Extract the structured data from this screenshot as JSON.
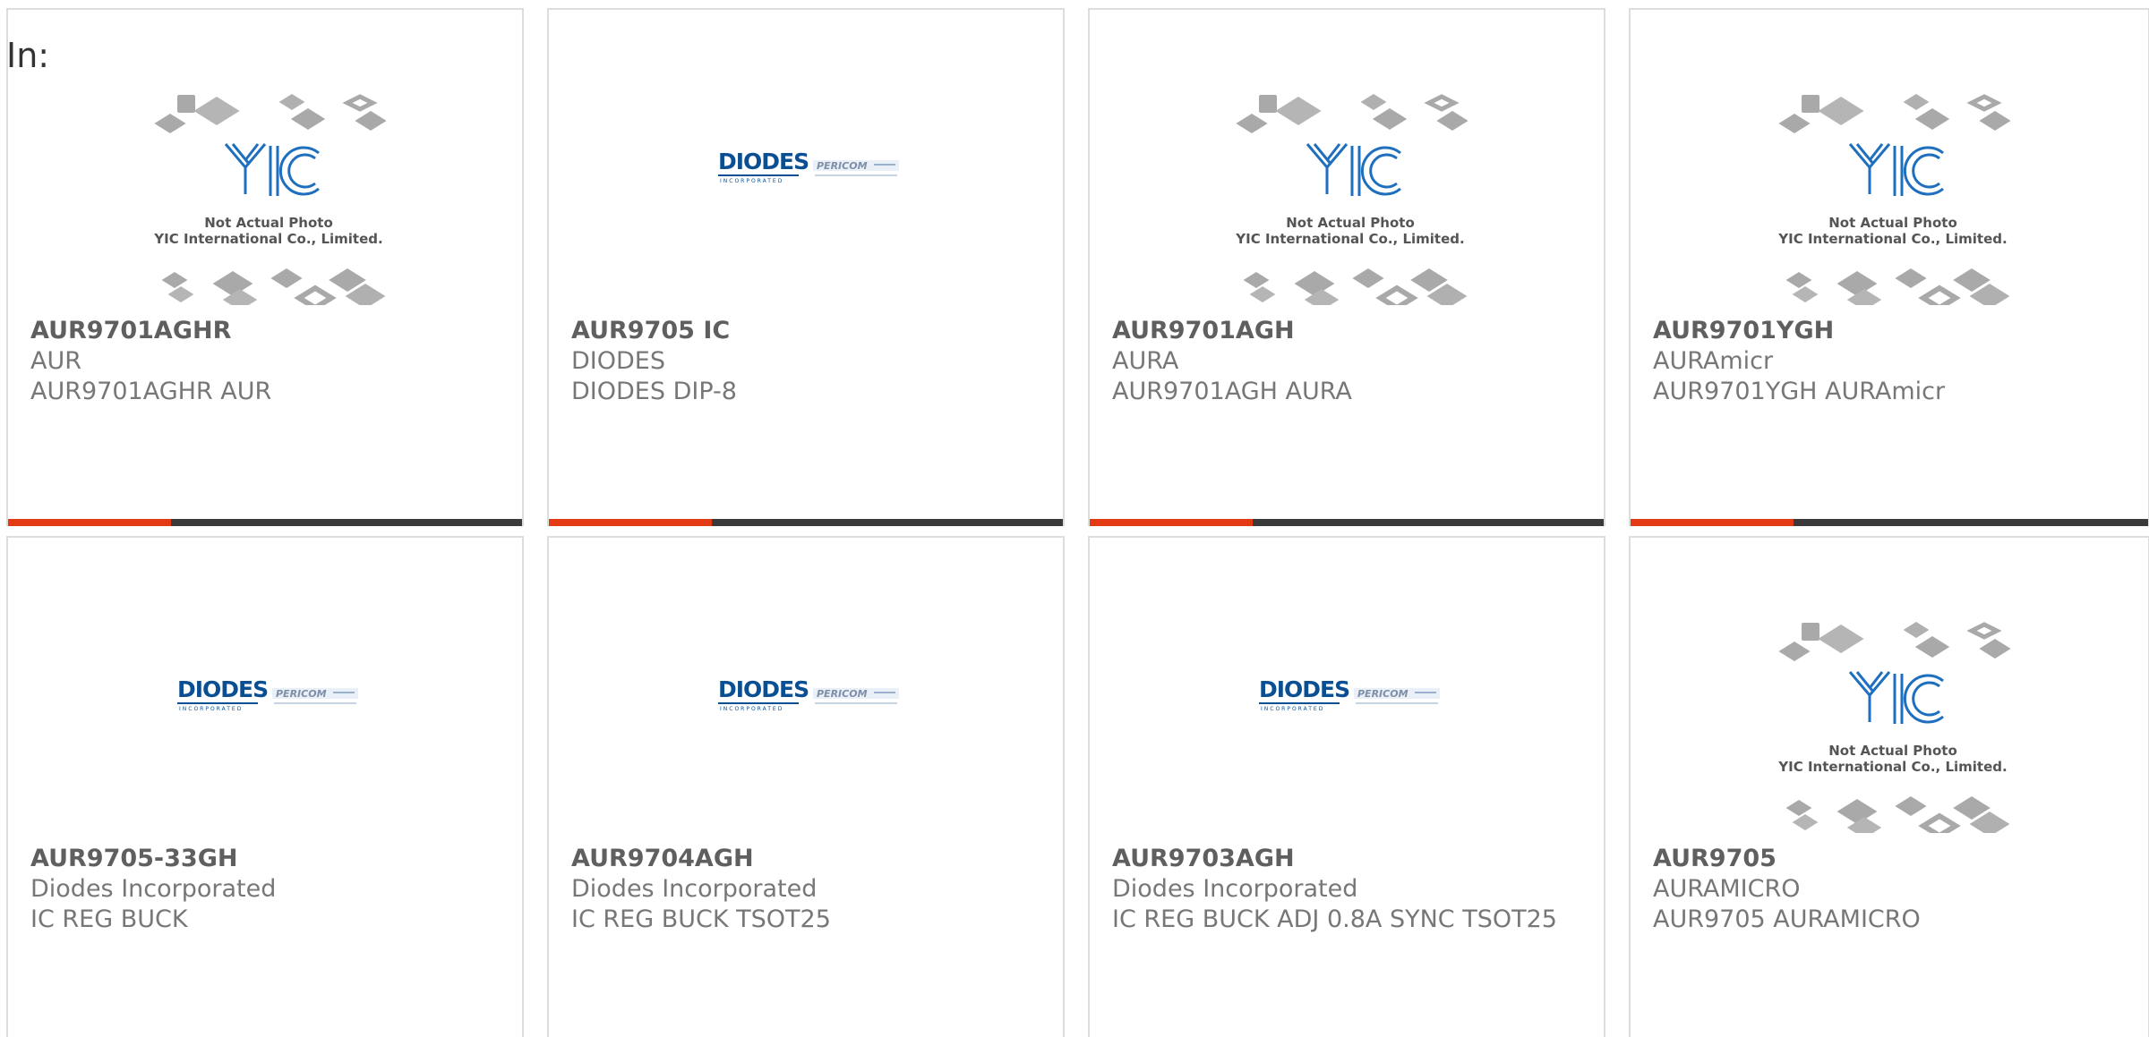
{
  "page": {
    "in_label": "In:"
  },
  "placeholder": {
    "line1": "Not Actual Photo",
    "line2": "YIC International Co., Limited.",
    "logo_text": "YIC"
  },
  "diodes_logo": {
    "brand": "DIODES",
    "sub": "INCORPORATED",
    "partner": "PERICOM"
  },
  "colors": {
    "accent": "#e23a12",
    "bar": "#3a3a3a",
    "text": "#777777",
    "title": "#5f5f5f"
  },
  "products": [
    {
      "part": "AUR9701AGHR",
      "manufacturer": "AUR",
      "description": "AUR9701AGHR AUR",
      "image": "placeholder"
    },
    {
      "part": "AUR9705 IC",
      "manufacturer": "DIODES",
      "description": "DIODES DIP-8",
      "image": "diodes-logo"
    },
    {
      "part": "AUR9701AGH",
      "manufacturer": "AURA",
      "description": "AUR9701AGH AURA",
      "image": "placeholder"
    },
    {
      "part": "AUR9701YGH",
      "manufacturer": "AURAmicr",
      "description": "AUR9701YGH AURAmicr",
      "image": "placeholder"
    },
    {
      "part": "AUR9705-33GH",
      "manufacturer": "Diodes Incorporated",
      "description": "IC REG BUCK",
      "image": "diodes-logo"
    },
    {
      "part": "AUR9704AGH",
      "manufacturer": "Diodes Incorporated",
      "description": "IC REG BUCK TSOT25",
      "image": "diodes-logo"
    },
    {
      "part": "AUR9703AGH",
      "manufacturer": "Diodes Incorporated",
      "description": "IC REG BUCK ADJ 0.8A SYNC TSOT25",
      "image": "diodes-logo"
    },
    {
      "part": "AUR9705",
      "manufacturer": "AURAMICRO",
      "description": "AUR9705 AURAMICRO",
      "image": "placeholder"
    }
  ]
}
